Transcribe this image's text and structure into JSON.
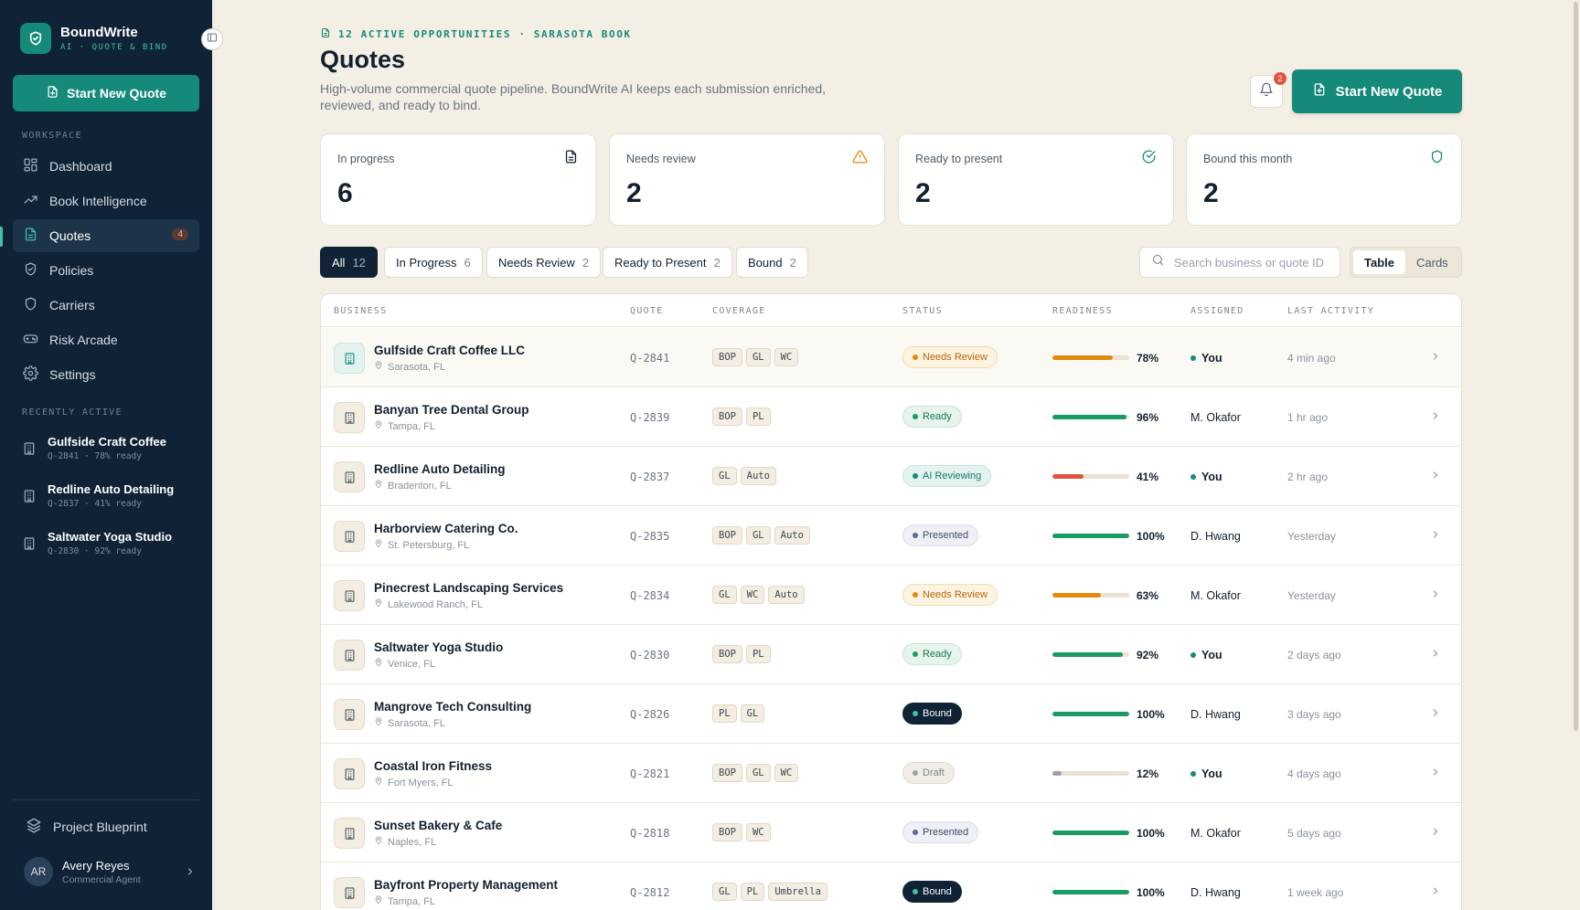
{
  "brand": {
    "name": "BoundWrite",
    "tagline": "AI · QUOTE & BIND"
  },
  "sidebar": {
    "new_quote_label": "Start New Quote",
    "workspace_label": "WORKSPACE",
    "items": [
      {
        "label": "Dashboard",
        "icon": "grid-icon"
      },
      {
        "label": "Book Intelligence",
        "icon": "trend-icon"
      },
      {
        "label": "Quotes",
        "icon": "document-icon",
        "count": "4",
        "active": true
      },
      {
        "label": "Policies",
        "icon": "shield-icon"
      },
      {
        "label": "Carriers",
        "icon": "shield-outline-icon"
      },
      {
        "label": "Risk Arcade",
        "icon": "gamepad-icon"
      },
      {
        "label": "Settings",
        "icon": "gear-icon"
      }
    ],
    "recent_label": "RECENTLY ACTIVE",
    "recent": [
      {
        "name": "Gulfside Craft Coffee",
        "meta": "Q-2841 · 78% ready"
      },
      {
        "name": "Redline Auto Detailing",
        "meta": "Q-2837 · 41% ready"
      },
      {
        "name": "Saltwater Yoga Studio",
        "meta": "Q-2830 · 92% ready"
      }
    ],
    "blueprint_label": "Project Blueprint",
    "user": {
      "initials": "AR",
      "name": "Avery Reyes",
      "role": "Commercial Agent"
    }
  },
  "header": {
    "eyebrow": "12 ACTIVE OPPORTUNITIES · SARASOTA BOOK",
    "title": "Quotes",
    "description": "High-volume commercial quote pipeline. BoundWrite AI keeps each submission enriched, reviewed, and ready to bind.",
    "notification_count": "2",
    "new_quote_label": "Start New Quote"
  },
  "stats": [
    {
      "label": "In progress",
      "value": "6",
      "icon": "document-icon",
      "color": "#13202e"
    },
    {
      "label": "Needs review",
      "value": "2",
      "icon": "warning-icon",
      "color": "#e38a0c"
    },
    {
      "label": "Ready to present",
      "value": "2",
      "icon": "check-circle-icon",
      "color": "#168a7a"
    },
    {
      "label": "Bound this month",
      "value": "2",
      "icon": "shield-icon",
      "color": "#168a7a"
    }
  ],
  "filters": [
    {
      "label": "All",
      "count": "12",
      "active": true
    },
    {
      "label": "In Progress",
      "count": "6"
    },
    {
      "label": "Needs Review",
      "count": "2"
    },
    {
      "label": "Ready to Present",
      "count": "2"
    },
    {
      "label": "Bound",
      "count": "2"
    }
  ],
  "search": {
    "placeholder": "Search business or quote ID"
  },
  "view_toggle": {
    "table": "Table",
    "cards": "Cards",
    "active": "Table"
  },
  "table": {
    "columns": [
      "BUSINESS",
      "QUOTE",
      "COVERAGE",
      "STATUS",
      "READINESS",
      "ASSIGNED",
      "LAST ACTIVITY"
    ],
    "rows": [
      {
        "business": "Gulfside Craft Coffee LLC",
        "location": "Sarasota, FL",
        "quote": "Q-2841",
        "coverage": [
          "BOP",
          "GL",
          "WC"
        ],
        "status": "Needs Review",
        "readiness": 78,
        "readiness_label": "78%",
        "assigned": "You",
        "last": "4 min ago"
      },
      {
        "business": "Banyan Tree Dental Group",
        "location": "Tampa, FL",
        "quote": "Q-2839",
        "coverage": [
          "BOP",
          "PL"
        ],
        "status": "Ready",
        "readiness": 96,
        "readiness_label": "96%",
        "assigned": "M. Okafor",
        "last": "1 hr ago"
      },
      {
        "business": "Redline Auto Detailing",
        "location": "Bradenton, FL",
        "quote": "Q-2837",
        "coverage": [
          "GL",
          "Auto"
        ],
        "status": "AI Reviewing",
        "readiness": 41,
        "readiness_label": "41%",
        "assigned": "You",
        "last": "2 hr ago"
      },
      {
        "business": "Harborview Catering Co.",
        "location": "St. Petersburg, FL",
        "quote": "Q-2835",
        "coverage": [
          "BOP",
          "GL",
          "Auto"
        ],
        "status": "Presented",
        "readiness": 100,
        "readiness_label": "100%",
        "assigned": "D. Hwang",
        "last": "Yesterday"
      },
      {
        "business": "Pinecrest Landscaping Services",
        "location": "Lakewood Ranch, FL",
        "quote": "Q-2834",
        "coverage": [
          "GL",
          "WC",
          "Auto"
        ],
        "status": "Needs Review",
        "readiness": 63,
        "readiness_label": "63%",
        "assigned": "M. Okafor",
        "last": "Yesterday"
      },
      {
        "business": "Saltwater Yoga Studio",
        "location": "Venice, FL",
        "quote": "Q-2830",
        "coverage": [
          "BOP",
          "PL"
        ],
        "status": "Ready",
        "readiness": 92,
        "readiness_label": "92%",
        "assigned": "You",
        "last": "2 days ago"
      },
      {
        "business": "Mangrove Tech Consulting",
        "location": "Sarasota, FL",
        "quote": "Q-2826",
        "coverage": [
          "PL",
          "GL"
        ],
        "status": "Bound",
        "readiness": 100,
        "readiness_label": "100%",
        "assigned": "D. Hwang",
        "last": "3 days ago"
      },
      {
        "business": "Coastal Iron Fitness",
        "location": "Fort Myers, FL",
        "quote": "Q-2821",
        "coverage": [
          "BOP",
          "GL",
          "WC"
        ],
        "status": "Draft",
        "readiness": 12,
        "readiness_label": "12%",
        "assigned": "You",
        "last": "4 days ago"
      },
      {
        "business": "Sunset Bakery & Cafe",
        "location": "Naples, FL",
        "quote": "Q-2818",
        "coverage": [
          "BOP",
          "WC"
        ],
        "status": "Presented",
        "readiness": 100,
        "readiness_label": "100%",
        "assigned": "M. Okafor",
        "last": "5 days ago"
      },
      {
        "business": "Bayfront Property Management",
        "location": "Tampa, FL",
        "quote": "Q-2812",
        "coverage": [
          "GL",
          "PL",
          "Umbrella"
        ],
        "status": "Bound",
        "readiness": 100,
        "readiness_label": "100%",
        "assigned": "D. Hwang",
        "last": "1 week ago"
      }
    ]
  },
  "status_styles": {
    "Needs Review": {
      "bg": "#fdf3e1",
      "border": "#f2dcae",
      "color": "#b8650a",
      "dot": "#e38a0c"
    },
    "Ready": {
      "bg": "#e6f4ec",
      "border": "#c8e6d3",
      "color": "#137a52",
      "dot": "#1b9a63"
    },
    "AI Reviewing": {
      "bg": "#e4f3ef",
      "border": "#c5e4dc",
      "color": "#137a6a",
      "dot": "#168a7a"
    },
    "Presented": {
      "bg": "#eef0f6",
      "border": "#d9deea",
      "color": "#3d4a66",
      "dot": "#5b6b92"
    },
    "Bound": {
      "bg": "#0f2236",
      "border": "#0f2236",
      "color": "#ffffff",
      "dot": "#3fc1a8"
    },
    "Draft": {
      "bg": "#f1ede6",
      "border": "#e0d9cc",
      "color": "#7d8792",
      "dot": "#9aa2ab"
    }
  },
  "readiness_colors": {
    "high": "#1b9a63",
    "mid": "#e38a0c",
    "low": "#e0533f",
    "draft": "#9aa2ab"
  }
}
